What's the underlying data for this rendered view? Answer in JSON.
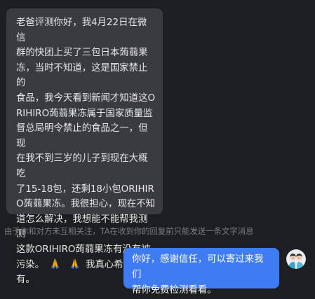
{
  "incoming_message": {
    "text_before_emoji": "老爸评测你好，我4月22日在微信\n群的快团上买了三包日本蒟蒻果\n冻，当时不知道，这是国家禁止的\n食品，我今天看到新闻才知道这O\nRIHIRO蒟蒻果冻属于国家质量监\n督总局明令禁止的食品之一，但现\n在我不到三岁的儿子到现在大概吃\n了15-18包，还剩18小包ORIHIR\nO蒟蒻果冻。我很担心，现在不知\n道怎么解决，我想能不能帮我测测\n这款ORIHIRO蒟蒻果冻有没有被\n污染。",
    "emoji_icons": [
      "folded-hands-emoji",
      "folded-hands-emoji"
    ],
    "text_after_emoji": "我真心希望没\n有。"
  },
  "system_notice": "由于你和对方未互相关注，TA在收到你的回复前只能发送一条文字消息",
  "outgoing_message": {
    "text": "你好，感谢信任，可以寄过来我们\n帮你免费检测看看。"
  },
  "avatar": {
    "icon": "user-avatar"
  },
  "colors": {
    "background": "#1d1e21",
    "incoming_bubble": "#3a3b40",
    "outgoing_bubble": "#3f7cf3",
    "notice_text": "#7c7d82"
  }
}
